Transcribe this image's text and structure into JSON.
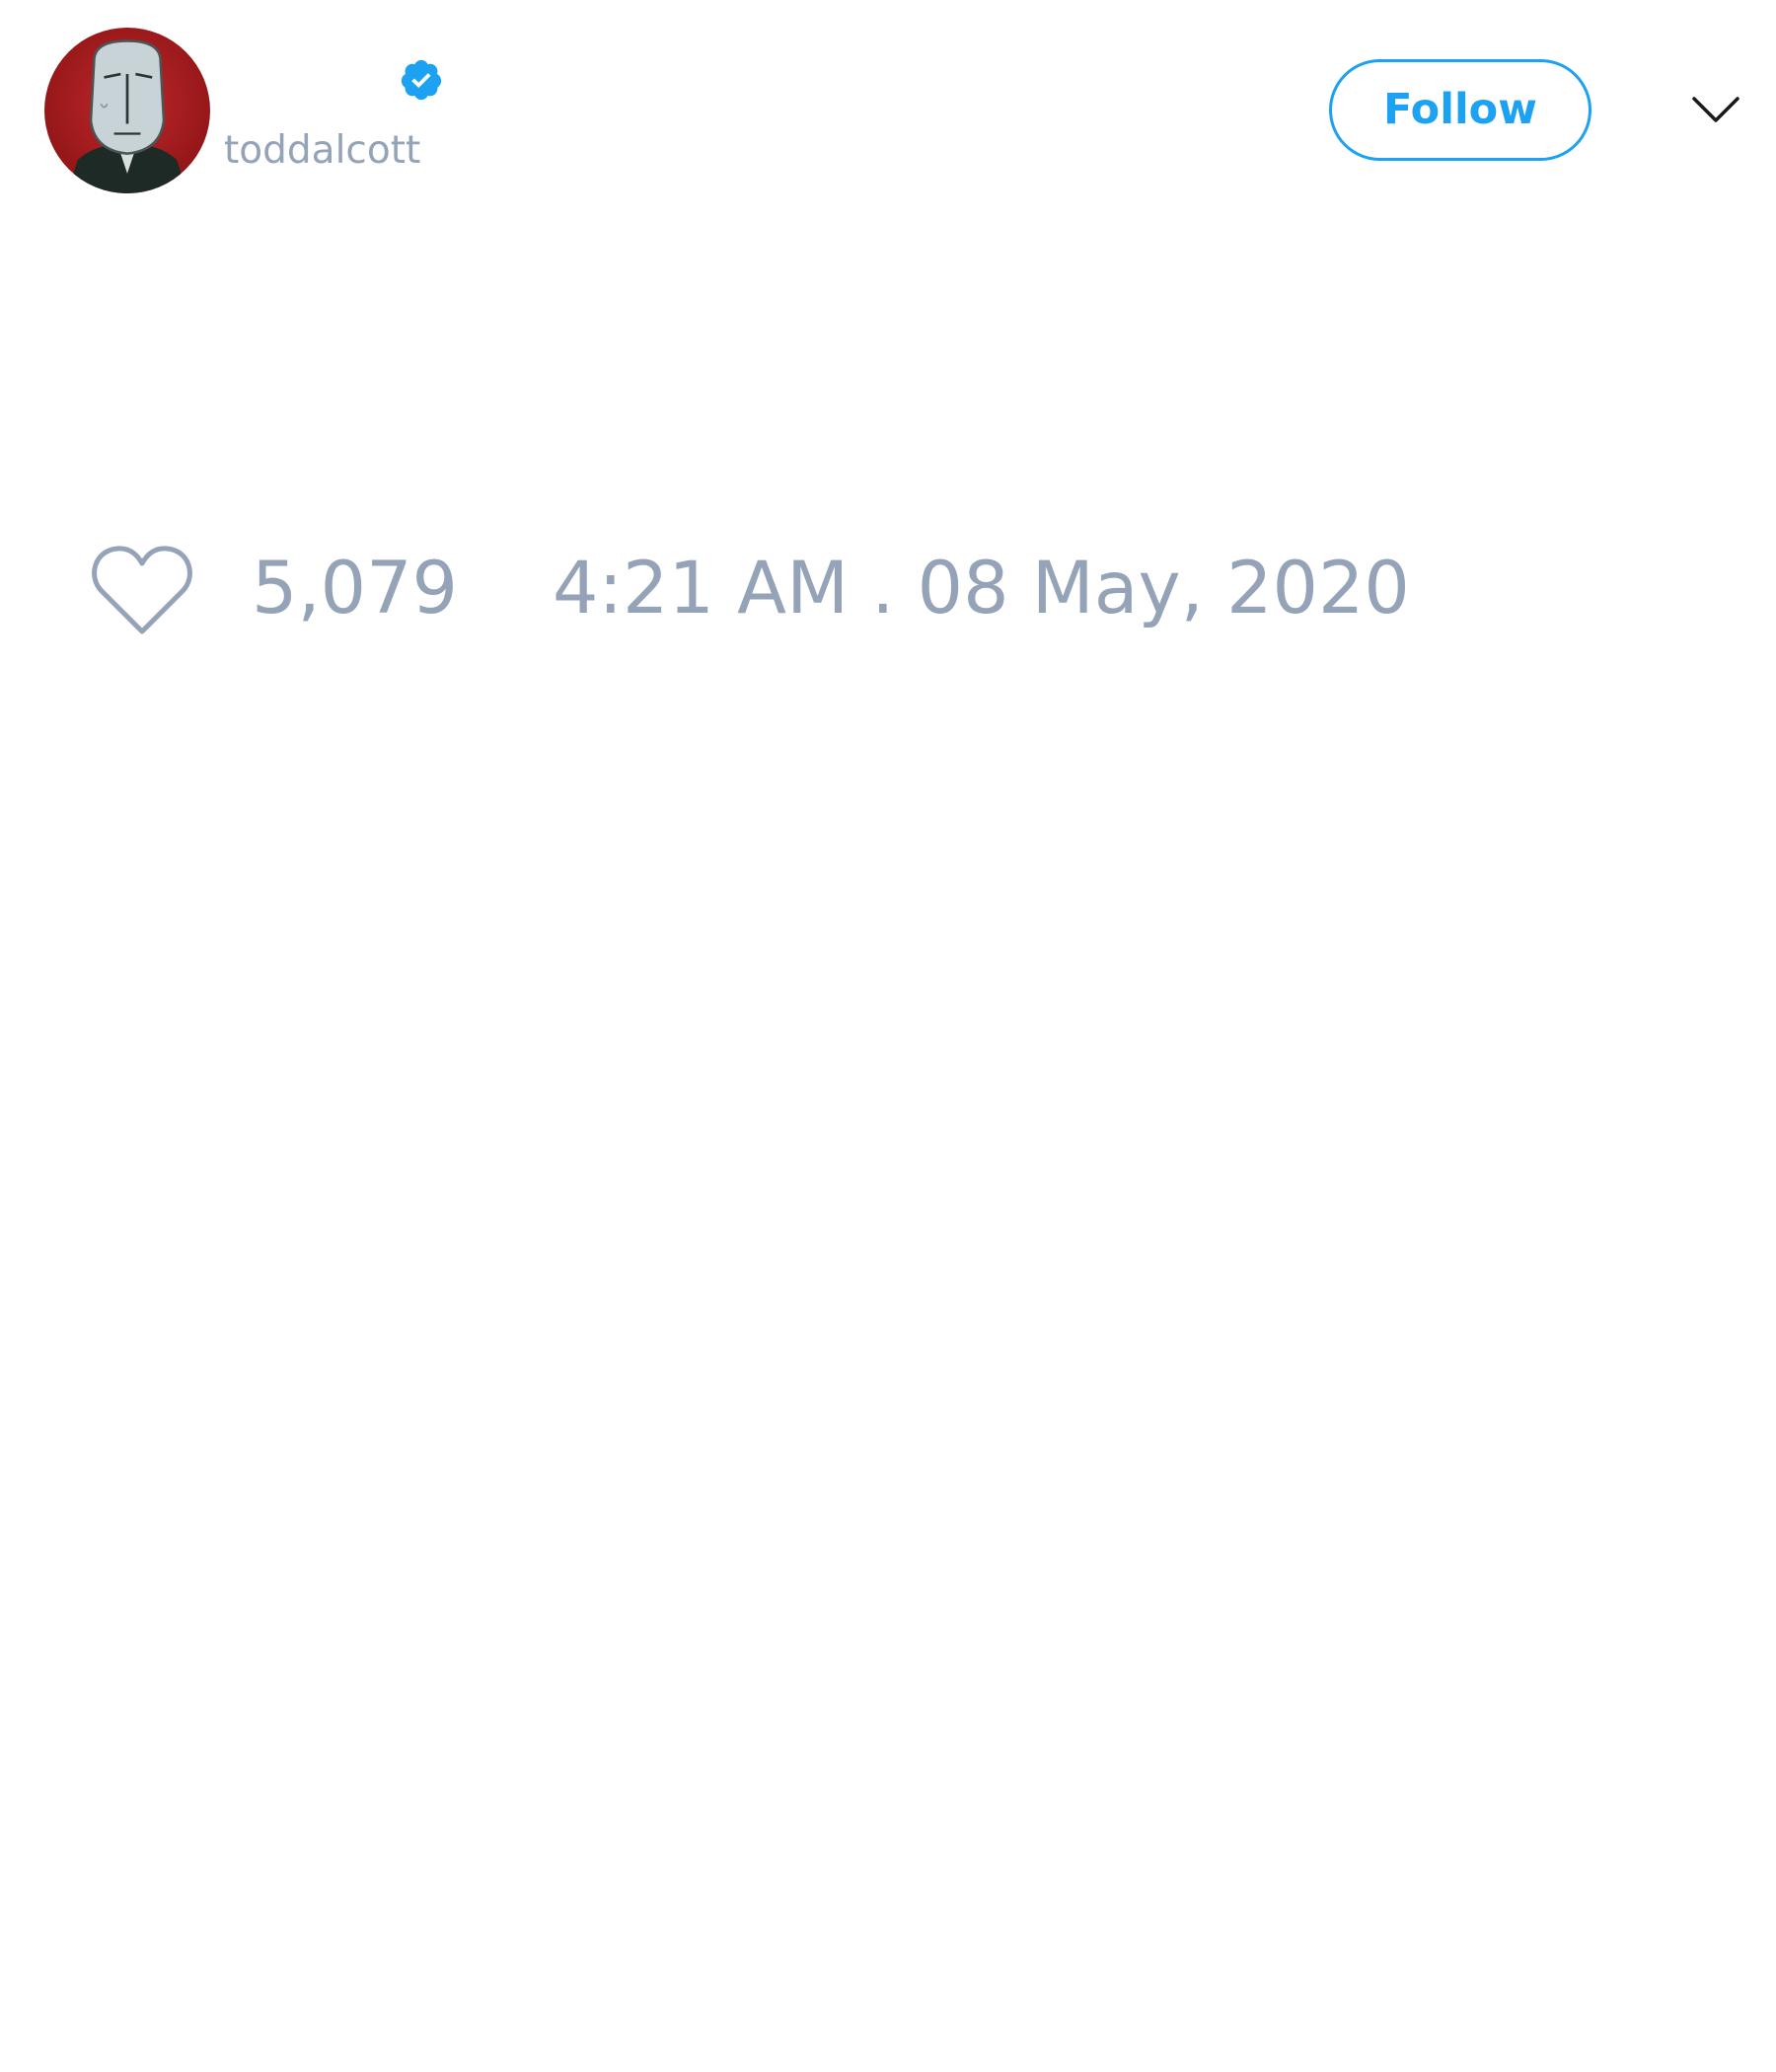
{
  "tweet": {
    "author": {
      "handle": "toddalcott",
      "verified": true,
      "avatar_icon": "portrait-avatar"
    },
    "follow_label": "Follow",
    "menu_icon": "chevron-down-icon",
    "like_icon": "heart-outline-icon",
    "like_count": "5,079",
    "timestamp": "4:21 AM . 08 May, 2020"
  },
  "colors": {
    "accent": "#1da1f2",
    "muted_text": "#95a3b8",
    "background": "#ffffff"
  }
}
